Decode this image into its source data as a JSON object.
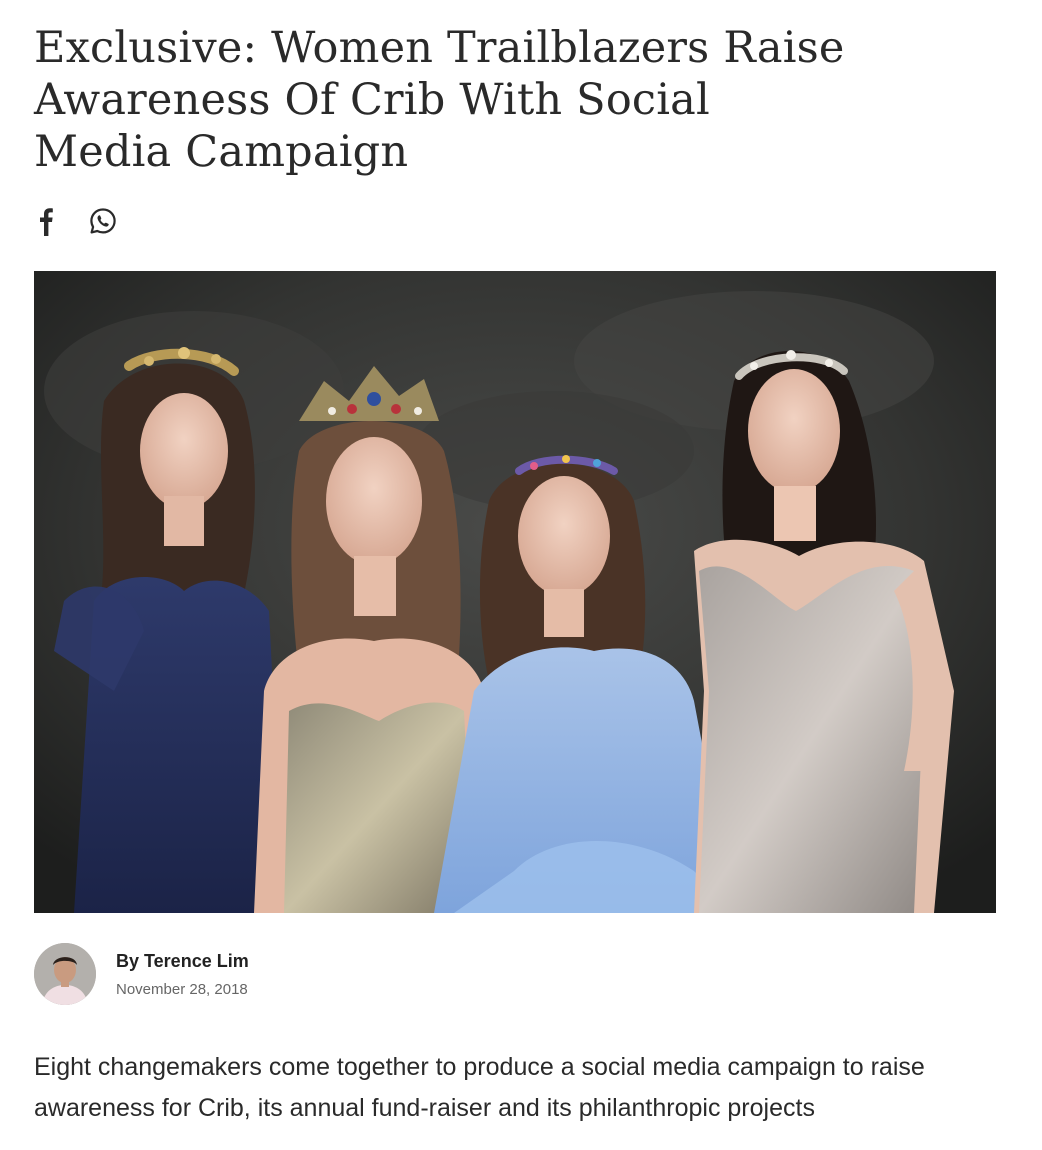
{
  "article": {
    "title": "Exclusive: Women Trailblazers Raise Awareness Of Crib With Social Media Campaign",
    "share": {
      "facebook_icon": "facebook-icon",
      "whatsapp_icon": "whatsapp-icon"
    },
    "hero_image": {
      "alt": "Four women in evening gowns wearing jewelled crowns and headbands"
    },
    "byline": {
      "author": "By Terence Lim",
      "date": "November 28, 2018"
    },
    "standfirst": "Eight changemakers come together to produce a social media campaign to raise awareness for Crib, its annual fund-raiser and its philanthropic projects"
  },
  "colors": {
    "text": "#222222",
    "muted": "#666666",
    "photo_backdrop": "#2b2c2b"
  }
}
